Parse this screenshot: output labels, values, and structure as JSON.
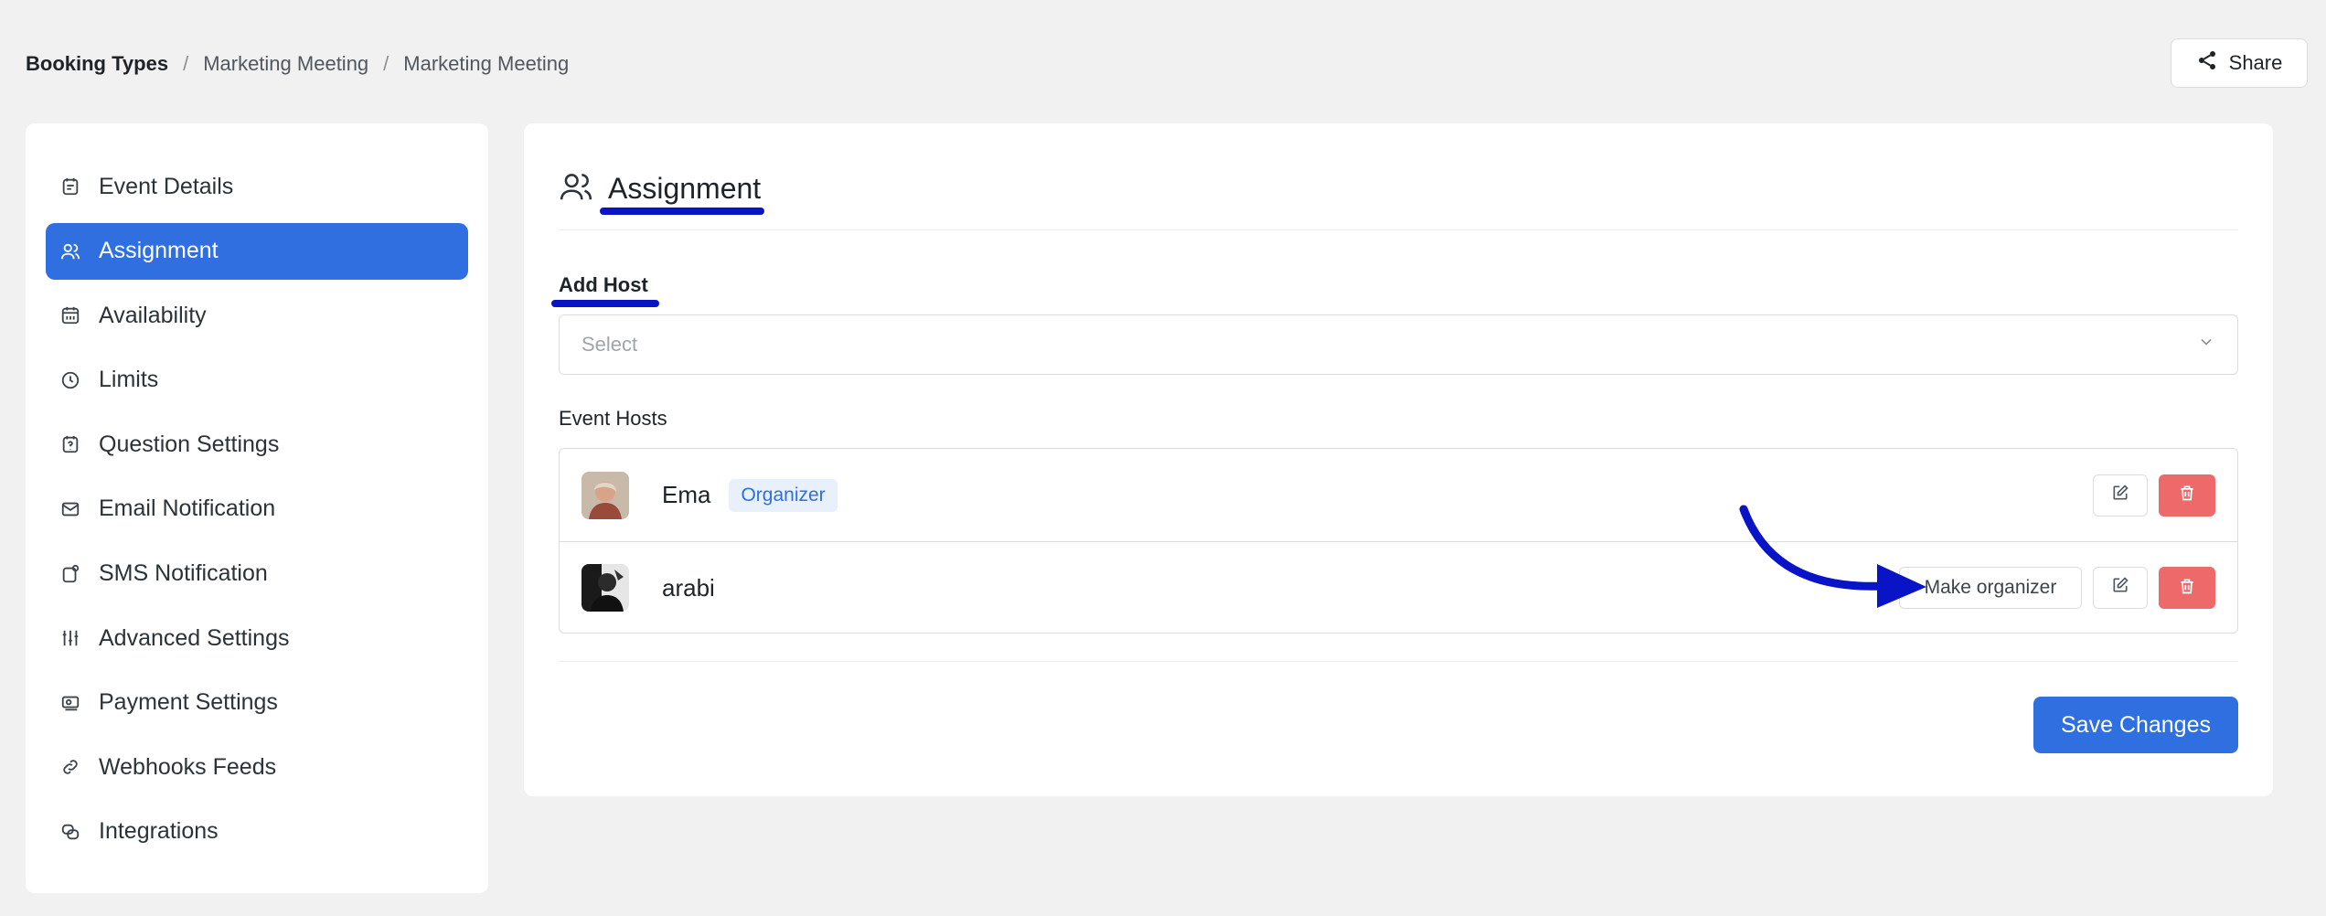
{
  "breadcrumb": {
    "root": "Booking Types",
    "level1": "Marketing Meeting",
    "level2": "Marketing Meeting",
    "separator": "/"
  },
  "header": {
    "share_label": "Share"
  },
  "sidebar": {
    "items": [
      {
        "label": "Event Details",
        "icon": "calendar-note-icon"
      },
      {
        "label": "Assignment",
        "icon": "users-icon",
        "active": true
      },
      {
        "label": "Availability",
        "icon": "calendar-grid-icon"
      },
      {
        "label": "Limits",
        "icon": "clock-icon"
      },
      {
        "label": "Question Settings",
        "icon": "question-calendar-icon"
      },
      {
        "label": "Email Notification",
        "icon": "mail-icon"
      },
      {
        "label": "SMS Notification",
        "icon": "sms-icon"
      },
      {
        "label": "Advanced Settings",
        "icon": "sliders-icon"
      },
      {
        "label": "Payment Settings",
        "icon": "payment-icon"
      },
      {
        "label": "Webhooks Feeds",
        "icon": "link-icon"
      },
      {
        "label": "Integrations",
        "icon": "integrations-icon"
      }
    ]
  },
  "main": {
    "title": "Assignment",
    "add_host_label": "Add Host",
    "select_placeholder": "Select",
    "event_hosts_label": "Event Hosts",
    "hosts": [
      {
        "name": "Ema",
        "badge": "Organizer"
      },
      {
        "name": "arabi",
        "action_label": "Make organizer"
      }
    ],
    "save_label": "Save Changes"
  },
  "colors": {
    "accent": "#2f6fe0",
    "danger": "#ee6a6a",
    "annotation": "#0a14c7"
  }
}
